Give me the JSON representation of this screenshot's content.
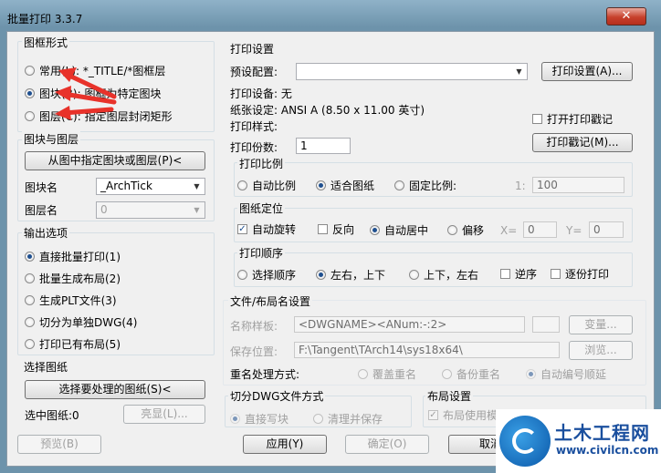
{
  "window": {
    "title": "批量打印 3.3.7",
    "close_label": "✕"
  },
  "frame_style": {
    "label": "图框形式",
    "options": [
      {
        "label": "常用(L): *_TITLE/*图框层",
        "checked": false
      },
      {
        "label": "图块(B): 图框为特定图块",
        "checked": true
      },
      {
        "label": "图层(C): 指定图层封闭矩形",
        "checked": false
      }
    ]
  },
  "block_layer": {
    "label": "图块与图层",
    "pick_button": "从图中指定图块或图层(P)<",
    "block_name_label": "图块名",
    "block_name_value": "_ArchTick",
    "layer_name_label": "图层名",
    "layer_name_value": "0"
  },
  "output": {
    "label": "输出选项",
    "options": [
      {
        "label": "直接批量打印(1)",
        "checked": true
      },
      {
        "label": "批量生成布局(2)",
        "checked": false
      },
      {
        "label": "生成PLT文件(3)",
        "checked": false
      },
      {
        "label": "切分为单独DWG(4)",
        "checked": false
      },
      {
        "label": "打印已有布局(5)",
        "checked": false
      }
    ]
  },
  "select_drawing": {
    "label": "选择图纸",
    "select_button": "选择要处理的图纸(S)<",
    "selected_label": "选中图纸:0",
    "highlight_button": "亮显(L)..."
  },
  "print_settings": {
    "label": "打印设置",
    "preset_label": "预设配置:",
    "preset_value": "",
    "settings_button": "打印设置(A)...",
    "device_label": "打印设备: 无",
    "paper_label": "纸张设定: ANSI A (8.50 x 11.00 英寸)",
    "style_label": "打印样式:",
    "stamp_checkbox": "打开打印戳记",
    "stamp_checked": false,
    "stamp_button": "打印戳记(M)...",
    "copies_label": "打印份数:",
    "copies_value": "1"
  },
  "scale": {
    "label": "打印比例",
    "options": [
      {
        "label": "自动比例",
        "checked": false
      },
      {
        "label": "适合图纸",
        "checked": true
      },
      {
        "label": "固定比例:",
        "checked": false
      }
    ],
    "ratio_prefix": "1:",
    "ratio_value": "100"
  },
  "position": {
    "label": "图纸定位",
    "auto_rotate": "自动旋转",
    "auto_rotate_checked": true,
    "reverse": "反向",
    "reverse_checked": false,
    "auto_center": "自动居中",
    "auto_center_checked": true,
    "offset": "偏移",
    "offset_checked": false,
    "x_label": "X=",
    "x_value": "0",
    "y_label": "Y=",
    "y_value": "0"
  },
  "order": {
    "label": "打印顺序",
    "options": [
      {
        "label": "选择顺序",
        "checked": false
      },
      {
        "label": "左右，上下",
        "checked": true
      },
      {
        "label": "上下，左右",
        "checked": false
      }
    ],
    "reverse_order": "逆序",
    "reverse_order_checked": false,
    "copy_by_copy": "逐份打印",
    "copy_by_copy_checked": false
  },
  "file_naming": {
    "label": "文件/布局名设置",
    "template_label": "名称样板:",
    "template_value": "<DWGNAME><ANum:-:2>",
    "variable_button": "变量...",
    "save_label": "保存位置:",
    "save_value": "F:\\Tangent\\TArch14\\sys18x64\\",
    "browse_button": "浏览...",
    "rename_label": "重名处理方式:",
    "rename_options": [
      {
        "label": "覆盖重名",
        "checked": false
      },
      {
        "label": "备份重名",
        "checked": false
      },
      {
        "label": "自动编号顺延",
        "checked": true
      }
    ]
  },
  "split_dwg": {
    "label": "切分DWG文件方式",
    "options": [
      {
        "label": "直接写块",
        "checked": true
      },
      {
        "label": "清理并保存",
        "checked": false
      }
    ]
  },
  "layout_settings": {
    "label": "布局设置",
    "use_template": "布局使用模",
    "use_template_checked": true
  },
  "footer": {
    "preview": "预览(B)",
    "apply": "应用(Y)",
    "ok": "确定(O)",
    "cancel": "取消"
  },
  "watermark": {
    "name": "土木工程网",
    "url": "www.civilcn.com"
  },
  "colors": {
    "annotation_arrow": "#e8322a",
    "title_bar": "#7fa3bb",
    "close_button": "#c7402c"
  }
}
